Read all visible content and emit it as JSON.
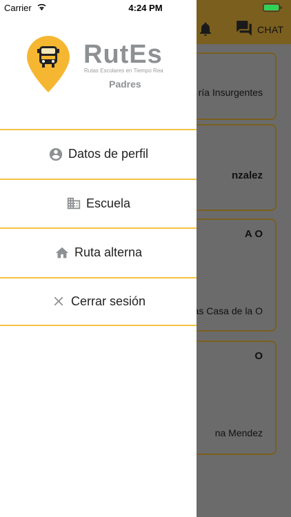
{
  "status_bar": {
    "carrier": "Carrier",
    "time": "4:24 PM"
  },
  "background": {
    "chat_label": "CHAT",
    "cards": [
      {
        "text": "ría Insurgentes"
      },
      {
        "text": "nzalez"
      },
      {
        "title": "A O",
        "text": "as Casa de la O"
      },
      {
        "title": "O",
        "text": "na Mendez"
      }
    ]
  },
  "drawer": {
    "logo": {
      "title": "RutEs",
      "tagline": "Rutas Escolares en Tiempo Rea",
      "subtitle": "Padres"
    },
    "menu": [
      {
        "label": "Datos de perfil",
        "icon": "account-circle-icon"
      },
      {
        "label": "Escuela",
        "icon": "building-icon"
      },
      {
        "label": "Ruta alterna",
        "icon": "home-icon"
      },
      {
        "label": "Cerrar sesión",
        "icon": "close-icon"
      }
    ]
  },
  "colors": {
    "accent": "#f5c242",
    "icon_gray": "#8e9193"
  }
}
